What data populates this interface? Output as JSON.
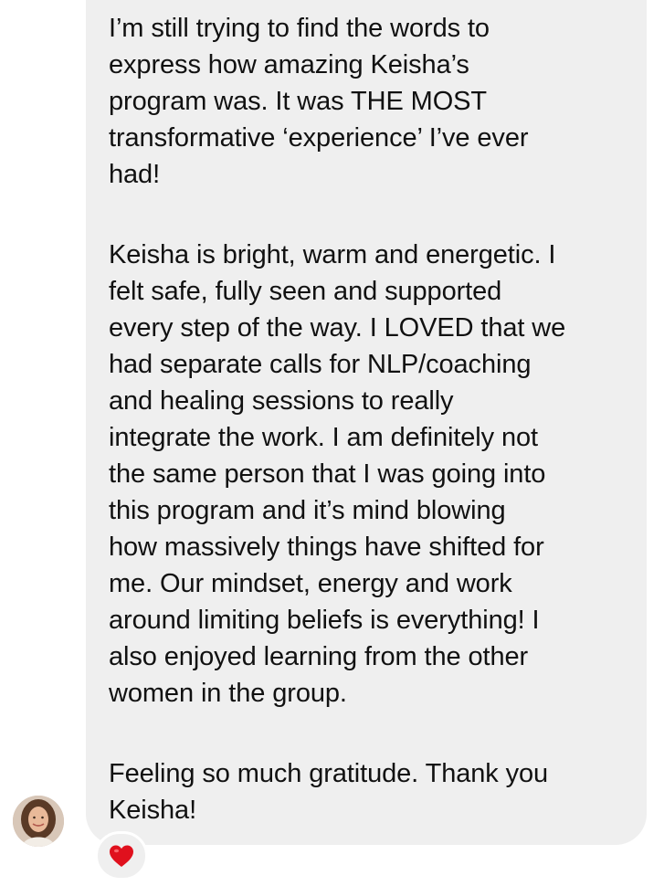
{
  "message": {
    "paragraphs": [
      "I’m still trying to find the words to\nexpress how amazing Keisha’s\nprogram was. It was THE MOST\ntransformative ‘experience’ I’ve ever\nhad!",
      "Keisha is bright, warm and energetic. I\nfelt safe, fully seen and supported\nevery step of the way. I LOVED that we\nhad separate calls for NLP/coaching\nand healing sessions to really\nintegrate the work. I am definitely not\nthe same person that I was going into\nthis program and it’s mind blowing\nhow massively things have shifted for\nme. Our mindset, energy and work\naround limiting beliefs is everything! I\nalso enjoyed learning from the other\nwomen in the group.",
      "Feeling so much gratitude. Thank you\nKeisha!"
    ]
  },
  "reaction": {
    "icon": "heart-icon",
    "color": "#e0101d"
  },
  "colors": {
    "bubble": "#efefef",
    "text": "#111111"
  }
}
